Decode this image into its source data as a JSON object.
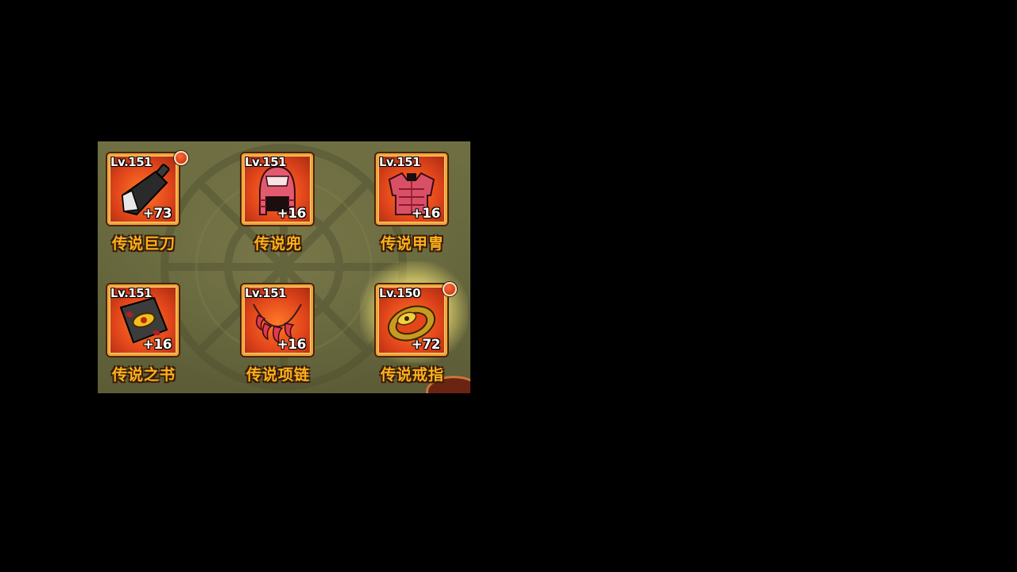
{
  "equipment": [
    {
      "name": "传说巨刀",
      "level": "Lv.151",
      "enhance": "+73",
      "icon": "cleaver-blade-icon",
      "has_notification": true,
      "highlighted": false
    },
    {
      "name": "传说兜",
      "level": "Lv.151",
      "enhance": "+16",
      "icon": "samurai-helmet-icon",
      "has_notification": false,
      "highlighted": false
    },
    {
      "name": "传说甲冑",
      "level": "Lv.151",
      "enhance": "+16",
      "icon": "armor-chest-icon",
      "has_notification": false,
      "highlighted": false
    },
    {
      "name": "传说之书",
      "level": "Lv.151",
      "enhance": "+16",
      "icon": "eye-tome-icon",
      "has_notification": false,
      "highlighted": false
    },
    {
      "name": "传说项链",
      "level": "Lv.151",
      "enhance": "+16",
      "icon": "fang-necklace-icon",
      "has_notification": false,
      "highlighted": false
    },
    {
      "name": "传说戒指",
      "level": "Lv.150",
      "enhance": "+72",
      "icon": "eye-ring-icon",
      "has_notification": true,
      "highlighted": true
    }
  ],
  "colors": {
    "item_name": "#ffb21c",
    "frame_border": "#f2a53a",
    "frame_fill": "#e2461b",
    "notification": "#c02a0a",
    "highlight_glow": "#fff5a0"
  }
}
